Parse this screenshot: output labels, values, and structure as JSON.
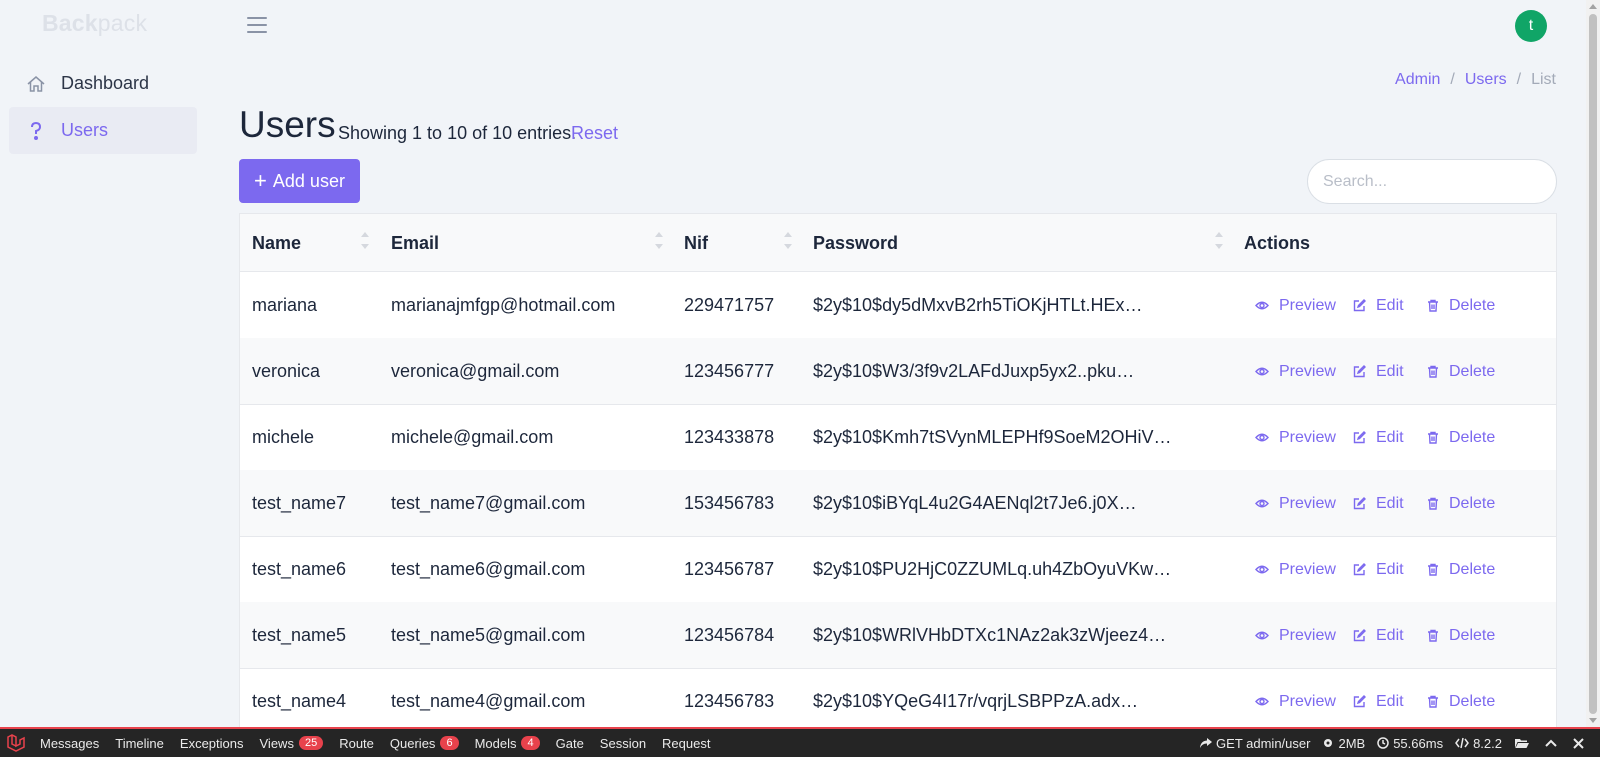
{
  "brand": {
    "bold": "Back",
    "light": "pack"
  },
  "sidebar": {
    "items": [
      {
        "label": "Dashboard",
        "icon": "home-icon"
      },
      {
        "label": "Users",
        "icon": "question-icon"
      }
    ]
  },
  "user": {
    "avatar_initial": "t"
  },
  "breadcrumb": {
    "items": [
      "Admin",
      "Users"
    ],
    "separator": "/",
    "current": "List"
  },
  "page": {
    "title": "Users",
    "subtitle": "Showing 1 to 10 of 10 entries.",
    "reset": "Reset",
    "add_button": "Add user",
    "search_placeholder": "Search..."
  },
  "table": {
    "headers": [
      "Name",
      "Email",
      "Nif",
      "Password",
      "Actions"
    ],
    "actions": {
      "preview": "Preview",
      "edit": "Edit",
      "delete": "Delete"
    },
    "rows": [
      {
        "name": "mariana",
        "email": "marianajmfgp@hotmail.com",
        "nif": "229471757",
        "password": "$2y$10$dy5dMxvB2rh5TiOKjHTLt.HEx…"
      },
      {
        "name": "veronica",
        "email": "veronica@gmail.com",
        "nif": "123456777",
        "password": "$2y$10$W3/3f9v2LAFdJuxp5yx2..pku…"
      },
      {
        "name": "michele",
        "email": "michele@gmail.com",
        "nif": "123433878",
        "password": "$2y$10$Kmh7tSVynMLEPHf9SoeM2OHiV…"
      },
      {
        "name": "test_name7",
        "email": "test_name7@gmail.com",
        "nif": "153456783",
        "password": "$2y$10$iBYqL4u2G4AENql2t7Je6.j0X…"
      },
      {
        "name": "test_name6",
        "email": "test_name6@gmail.com",
        "nif": "123456787",
        "password": "$2y$10$PU2HjC0ZZUMLq.uh4ZbOyuVKw…"
      },
      {
        "name": "test_name5",
        "email": "test_name5@gmail.com",
        "nif": "123456784",
        "password": "$2y$10$WRlVHbDTXc1NAz2ak3zWjeez4…"
      },
      {
        "name": "test_name4",
        "email": "test_name4@gmail.com",
        "nif": "123456783",
        "password": "$2y$10$YQeG4I17r/vqrjLSBPPzA.adx…"
      }
    ]
  },
  "debugbar": {
    "tabs": [
      {
        "label": "Messages"
      },
      {
        "label": "Timeline"
      },
      {
        "label": "Exceptions"
      },
      {
        "label": "Views",
        "badge": "25"
      },
      {
        "label": "Route"
      },
      {
        "label": "Queries",
        "badge": "6"
      },
      {
        "label": "Models",
        "badge": "4"
      },
      {
        "label": "Gate"
      },
      {
        "label": "Session"
      },
      {
        "label": "Request"
      }
    ],
    "request": "GET admin/user",
    "memory": "2MB",
    "time": "55.66ms",
    "php_version": "8.2.2"
  },
  "colors": {
    "accent": "#7c69ef",
    "avatar": "#10a567",
    "debug_red": "#e8424c"
  }
}
